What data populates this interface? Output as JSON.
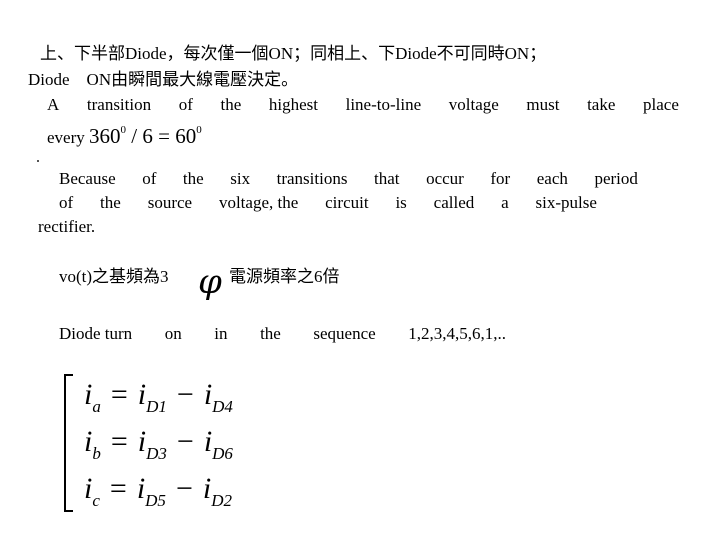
{
  "slide": {
    "line1": "上、下半部Diode，每次僅一個ON；同相上、下Diode不可同時ON；",
    "line2": "Diode　ON由瞬間最大線電壓決定。",
    "transition": {
      "words": [
        "A",
        "transition",
        "of",
        "the",
        "highest",
        "line-to-line",
        "voltage",
        "must",
        "take",
        "place"
      ],
      "every_label": "every",
      "formula": {
        "num": "360",
        "deg": "0",
        "div": " / 6 = ",
        "res": "60",
        "res_deg": "0"
      }
    },
    "because": {
      "line1_words": [
        "Because",
        "of",
        "the",
        "six",
        "transitions",
        "that",
        "occur",
        "for",
        "each",
        "period"
      ],
      "line2_words": [
        "of",
        "the",
        "source",
        "voltage, the",
        "circuit",
        "is",
        "called",
        "a",
        "six-pulse"
      ],
      "line3": "rectifier."
    },
    "freq": {
      "left": "vo(t)之基頻為3",
      "phi_symbol": "φ",
      "right": "電源頻率之6倍"
    },
    "sequence": {
      "words": [
        "Diode turn",
        "on",
        "in",
        "the",
        "sequence",
        "1,2,3,4,5,6,1,.."
      ]
    },
    "equations": [
      {
        "lhs": "i",
        "lhs_sub": "a",
        "op1": "=",
        "t1": "i",
        "t1_sub": "D1",
        "op2": "−",
        "t2": "i",
        "t2_sub": "D4"
      },
      {
        "lhs": "i",
        "lhs_sub": "b",
        "op1": "=",
        "t1": "i",
        "t1_sub": "D3",
        "op2": "−",
        "t2": "i",
        "t2_sub": "D6"
      },
      {
        "lhs": "i",
        "lhs_sub": "c",
        "op1": "=",
        "t1": "i",
        "t1_sub": "D5",
        "op2": "−",
        "t2": "i",
        "t2_sub": "D2"
      }
    ]
  }
}
